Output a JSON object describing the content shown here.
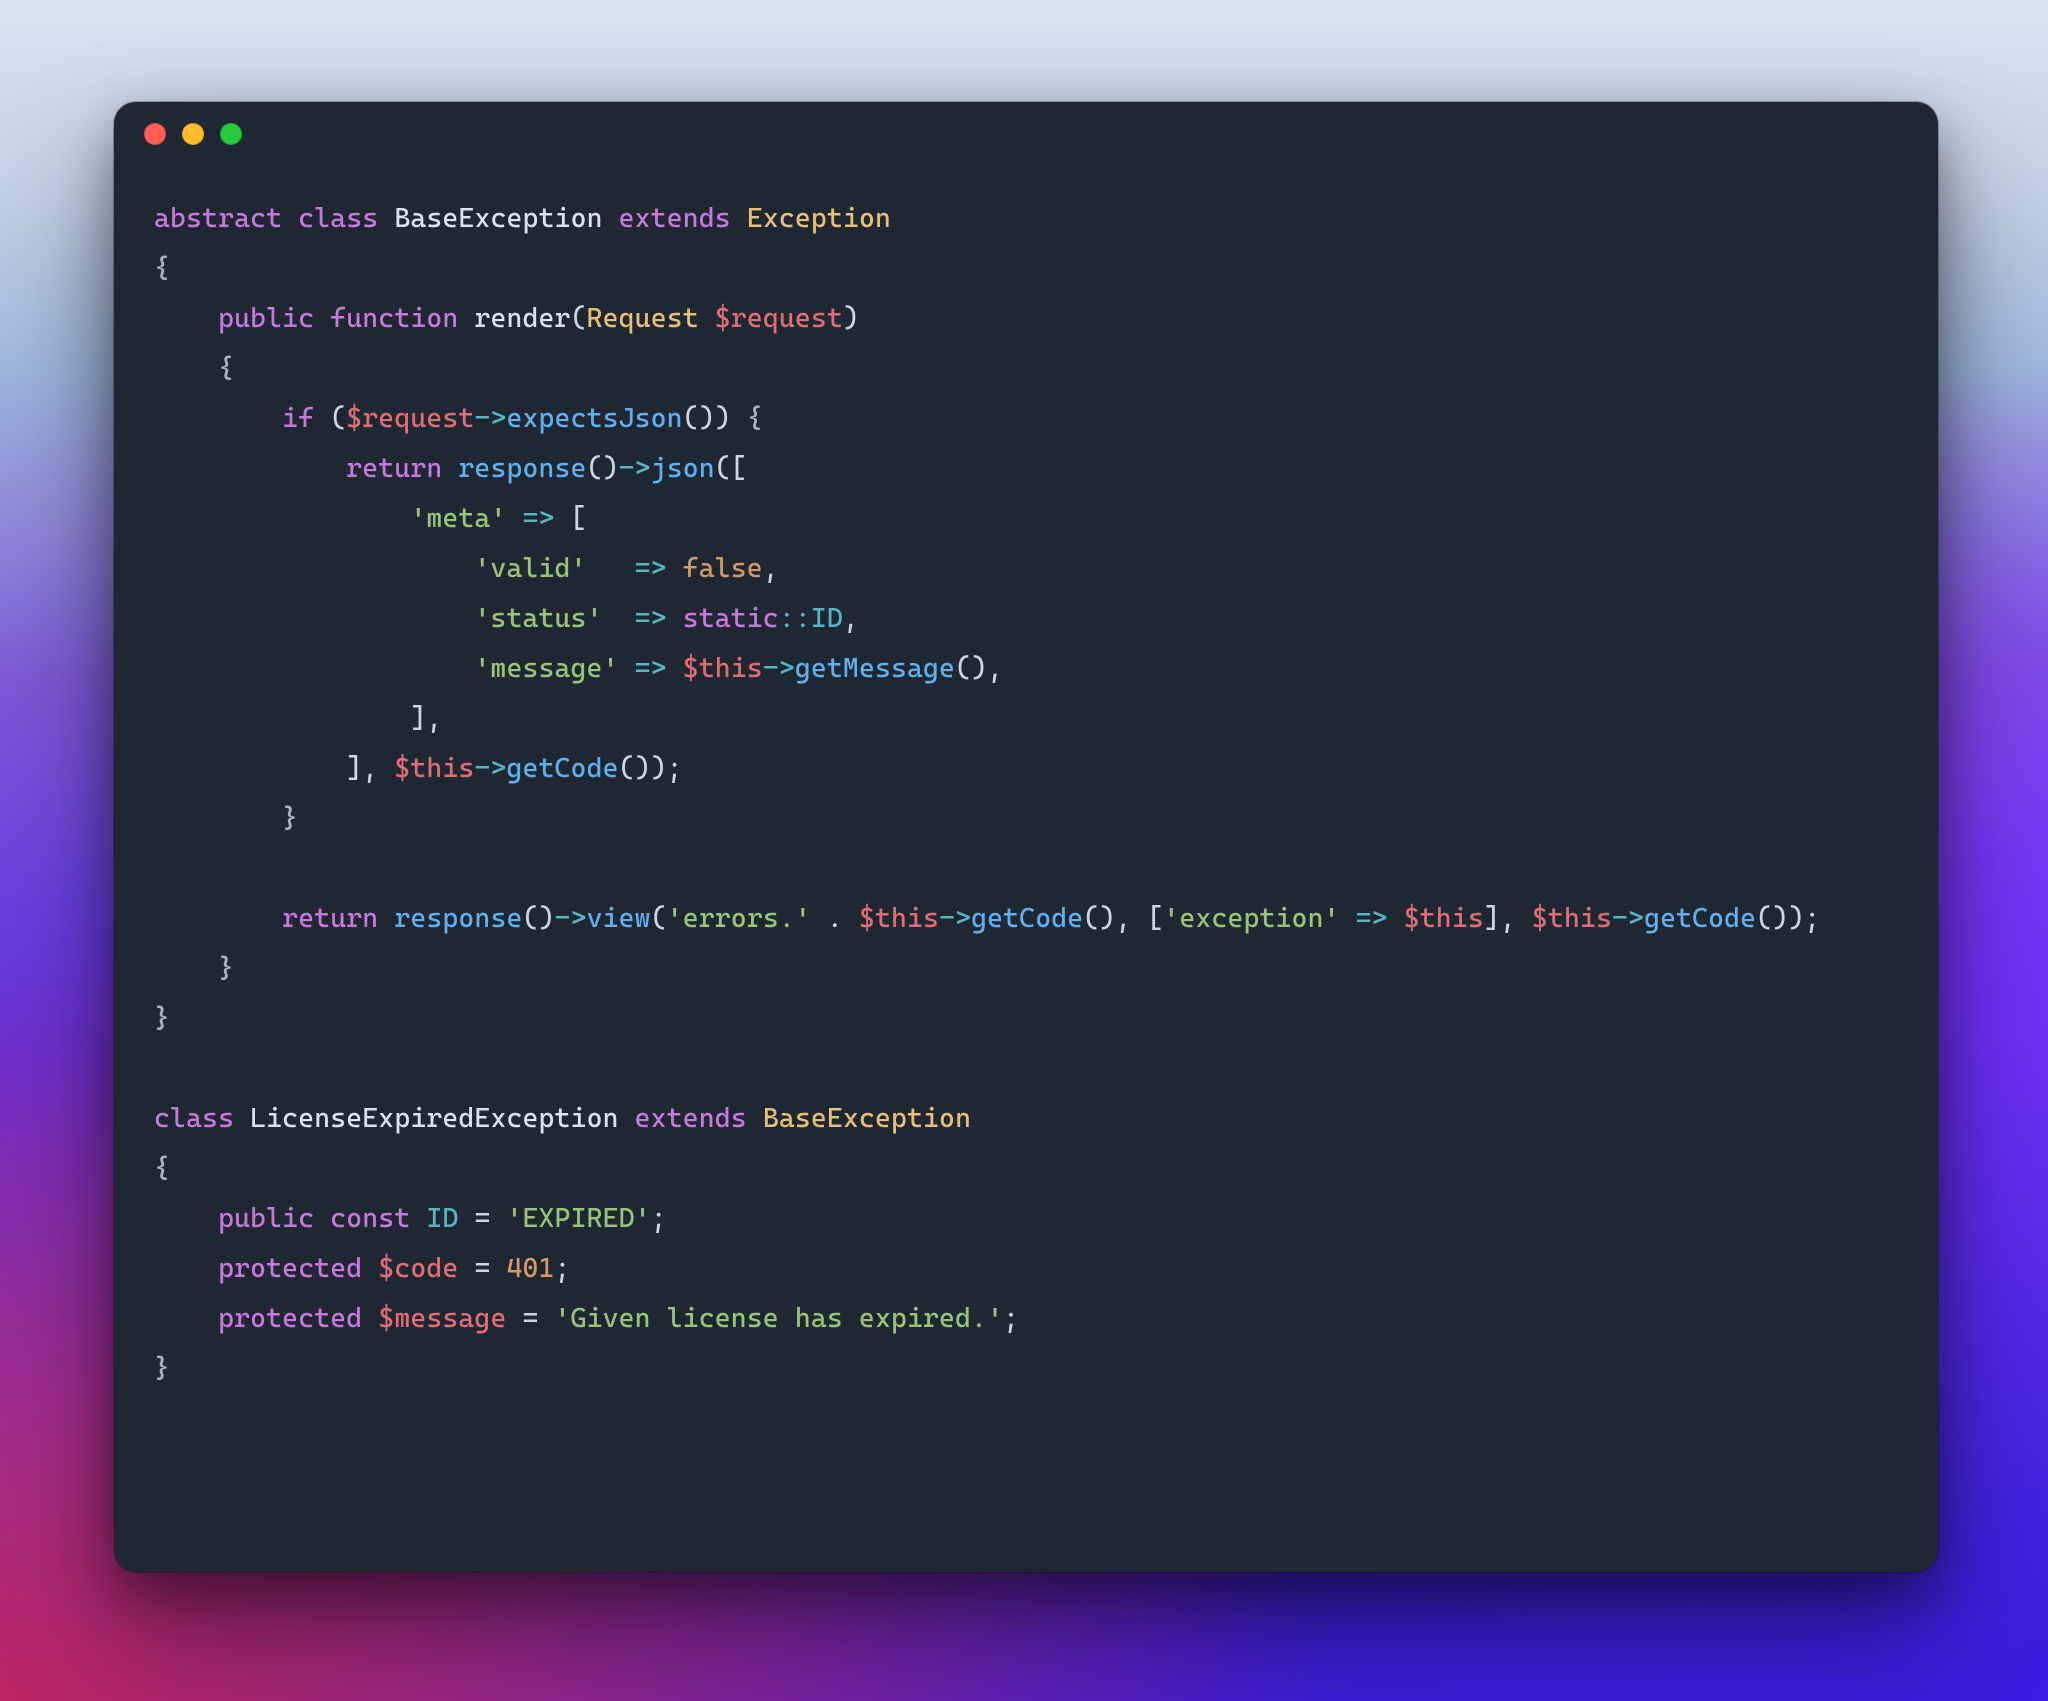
{
  "colors": {
    "editor_bg": "#1f2733",
    "keyword": "#c678dd",
    "function": "#61afef",
    "type": "#e5c07b",
    "variable": "#e06c75",
    "string": "#98c379",
    "number": "#d19a66",
    "constant": "#56b6c2",
    "default": "#cbd6e4"
  },
  "window": {
    "traffic_lights": [
      "close",
      "minimize",
      "zoom"
    ]
  },
  "code": {
    "lines": [
      [
        {
          "c": "k",
          "t": "abstract"
        },
        {
          "c": "p",
          "t": " "
        },
        {
          "c": "k",
          "t": "class"
        },
        {
          "c": "p",
          "t": " "
        },
        {
          "c": "id",
          "t": "BaseException"
        },
        {
          "c": "p",
          "t": " "
        },
        {
          "c": "k",
          "t": "extends"
        },
        {
          "c": "p",
          "t": " "
        },
        {
          "c": "t",
          "t": "Exception"
        }
      ],
      [
        {
          "c": "br",
          "t": "{"
        }
      ],
      [
        {
          "c": "p",
          "t": "    "
        },
        {
          "c": "k",
          "t": "public"
        },
        {
          "c": "p",
          "t": " "
        },
        {
          "c": "k",
          "t": "function"
        },
        {
          "c": "p",
          "t": " "
        },
        {
          "c": "id",
          "t": "render"
        },
        {
          "c": "p",
          "t": "("
        },
        {
          "c": "t",
          "t": "Request"
        },
        {
          "c": "p",
          "t": " "
        },
        {
          "c": "v",
          "t": "$request"
        },
        {
          "c": "p",
          "t": ")"
        }
      ],
      [
        {
          "c": "p",
          "t": "    "
        },
        {
          "c": "br",
          "t": "{"
        }
      ],
      [
        {
          "c": "p",
          "t": "        "
        },
        {
          "c": "k",
          "t": "if"
        },
        {
          "c": "p",
          "t": " ("
        },
        {
          "c": "v",
          "t": "$request"
        },
        {
          "c": "op",
          "t": "->"
        },
        {
          "c": "fn",
          "t": "expectsJson"
        },
        {
          "c": "p",
          "t": "()) "
        },
        {
          "c": "br",
          "t": "{"
        }
      ],
      [
        {
          "c": "p",
          "t": "            "
        },
        {
          "c": "k",
          "t": "return"
        },
        {
          "c": "p",
          "t": " "
        },
        {
          "c": "fn",
          "t": "response"
        },
        {
          "c": "p",
          "t": "()"
        },
        {
          "c": "op",
          "t": "->"
        },
        {
          "c": "fn",
          "t": "json"
        },
        {
          "c": "p",
          "t": "(["
        }
      ],
      [
        {
          "c": "p",
          "t": "                "
        },
        {
          "c": "s",
          "t": "'meta'"
        },
        {
          "c": "p",
          "t": " "
        },
        {
          "c": "op",
          "t": "=>"
        },
        {
          "c": "p",
          "t": " ["
        }
      ],
      [
        {
          "c": "p",
          "t": "                    "
        },
        {
          "c": "s",
          "t": "'valid'"
        },
        {
          "c": "p",
          "t": "   "
        },
        {
          "c": "op",
          "t": "=>"
        },
        {
          "c": "p",
          "t": " "
        },
        {
          "c": "n",
          "t": "false"
        },
        {
          "c": "p",
          "t": ","
        }
      ],
      [
        {
          "c": "p",
          "t": "                    "
        },
        {
          "c": "s",
          "t": "'status'"
        },
        {
          "c": "p",
          "t": "  "
        },
        {
          "c": "op",
          "t": "=>"
        },
        {
          "c": "p",
          "t": " "
        },
        {
          "c": "k",
          "t": "static"
        },
        {
          "c": "op",
          "t": "::"
        },
        {
          "c": "cst",
          "t": "ID"
        },
        {
          "c": "p",
          "t": ","
        }
      ],
      [
        {
          "c": "p",
          "t": "                    "
        },
        {
          "c": "s",
          "t": "'message'"
        },
        {
          "c": "p",
          "t": " "
        },
        {
          "c": "op",
          "t": "=>"
        },
        {
          "c": "p",
          "t": " "
        },
        {
          "c": "v",
          "t": "$this"
        },
        {
          "c": "op",
          "t": "->"
        },
        {
          "c": "fn",
          "t": "getMessage"
        },
        {
          "c": "p",
          "t": "(),"
        }
      ],
      [
        {
          "c": "p",
          "t": "                ],"
        }
      ],
      [
        {
          "c": "p",
          "t": "            ], "
        },
        {
          "c": "v",
          "t": "$this"
        },
        {
          "c": "op",
          "t": "->"
        },
        {
          "c": "fn",
          "t": "getCode"
        },
        {
          "c": "p",
          "t": "());"
        }
      ],
      [
        {
          "c": "p",
          "t": "        "
        },
        {
          "c": "br",
          "t": "}"
        }
      ],
      [],
      [
        {
          "c": "p",
          "t": "        "
        },
        {
          "c": "k",
          "t": "return"
        },
        {
          "c": "p",
          "t": " "
        },
        {
          "c": "fn",
          "t": "response"
        },
        {
          "c": "p",
          "t": "()"
        },
        {
          "c": "op",
          "t": "->"
        },
        {
          "c": "fn",
          "t": "view"
        },
        {
          "c": "p",
          "t": "("
        },
        {
          "c": "s",
          "t": "'errors.'"
        },
        {
          "c": "p",
          "t": " . "
        },
        {
          "c": "v",
          "t": "$this"
        },
        {
          "c": "op",
          "t": "->"
        },
        {
          "c": "fn",
          "t": "getCode"
        },
        {
          "c": "p",
          "t": "(), ["
        },
        {
          "c": "s",
          "t": "'exception'"
        },
        {
          "c": "p",
          "t": " "
        },
        {
          "c": "op",
          "t": "=>"
        },
        {
          "c": "p",
          "t": " "
        },
        {
          "c": "v",
          "t": "$this"
        },
        {
          "c": "p",
          "t": "], "
        },
        {
          "c": "v",
          "t": "$this"
        },
        {
          "c": "op",
          "t": "->"
        },
        {
          "c": "fn",
          "t": "getCode"
        },
        {
          "c": "p",
          "t": "());"
        }
      ],
      [
        {
          "c": "p",
          "t": "    "
        },
        {
          "c": "br",
          "t": "}"
        }
      ],
      [
        {
          "c": "br",
          "t": "}"
        }
      ],
      [],
      [
        {
          "c": "k",
          "t": "class"
        },
        {
          "c": "p",
          "t": " "
        },
        {
          "c": "id",
          "t": "LicenseExpiredException"
        },
        {
          "c": "p",
          "t": " "
        },
        {
          "c": "k",
          "t": "extends"
        },
        {
          "c": "p",
          "t": " "
        },
        {
          "c": "t",
          "t": "BaseException"
        }
      ],
      [
        {
          "c": "br",
          "t": "{"
        }
      ],
      [
        {
          "c": "p",
          "t": "    "
        },
        {
          "c": "k",
          "t": "public"
        },
        {
          "c": "p",
          "t": " "
        },
        {
          "c": "k",
          "t": "const"
        },
        {
          "c": "p",
          "t": " "
        },
        {
          "c": "cst",
          "t": "ID"
        },
        {
          "c": "p",
          "t": " = "
        },
        {
          "c": "s",
          "t": "'EXPIRED'"
        },
        {
          "c": "p",
          "t": ";"
        }
      ],
      [
        {
          "c": "p",
          "t": "    "
        },
        {
          "c": "k",
          "t": "protected"
        },
        {
          "c": "p",
          "t": " "
        },
        {
          "c": "v",
          "t": "$code"
        },
        {
          "c": "p",
          "t": " = "
        },
        {
          "c": "n",
          "t": "401"
        },
        {
          "c": "p",
          "t": ";"
        }
      ],
      [
        {
          "c": "p",
          "t": "    "
        },
        {
          "c": "k",
          "t": "protected"
        },
        {
          "c": "p",
          "t": " "
        },
        {
          "c": "v",
          "t": "$message"
        },
        {
          "c": "p",
          "t": " = "
        },
        {
          "c": "s",
          "t": "'Given license has expired.'"
        },
        {
          "c": "p",
          "t": ";"
        }
      ],
      [
        {
          "c": "br",
          "t": "}"
        }
      ]
    ]
  }
}
